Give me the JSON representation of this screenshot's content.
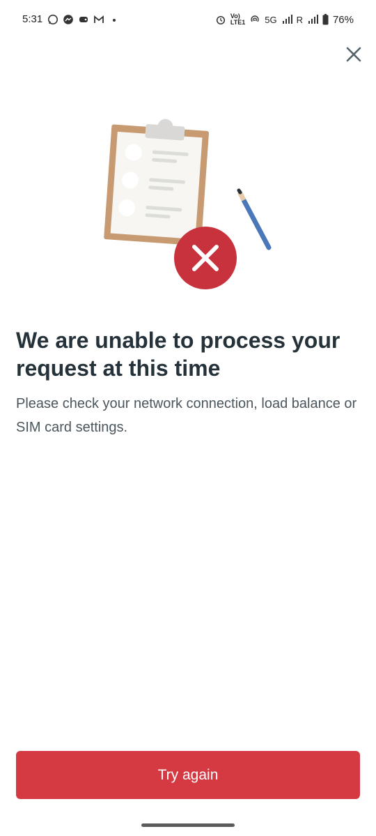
{
  "status_bar": {
    "time": "5:31",
    "volte": "Vo)",
    "lte": "LTE1",
    "network": "5G",
    "roaming": "R",
    "battery": "76%",
    "left_icons": [
      "whatsapp-icon",
      "messenger-icon",
      "game-icon",
      "gmail-icon",
      "dot-icon"
    ],
    "right_icons": [
      "alarm-icon",
      "hotspot-icon",
      "signal-icon",
      "battery-icon"
    ]
  },
  "dialog": {
    "title": "We are unable to process your request at this time",
    "message": "Please check your network connection, load balance or SIM card settings.",
    "button_label": "Try again",
    "close_icon": "close-icon",
    "illustration": "clipboard-error-illustration"
  },
  "colors": {
    "primary": "#d53a43",
    "title_text": "#26323a",
    "body_text": "#4a555c",
    "clipboard": "#c89a72",
    "error_badge": "#c8323d",
    "pencil": "#4a78b8"
  }
}
